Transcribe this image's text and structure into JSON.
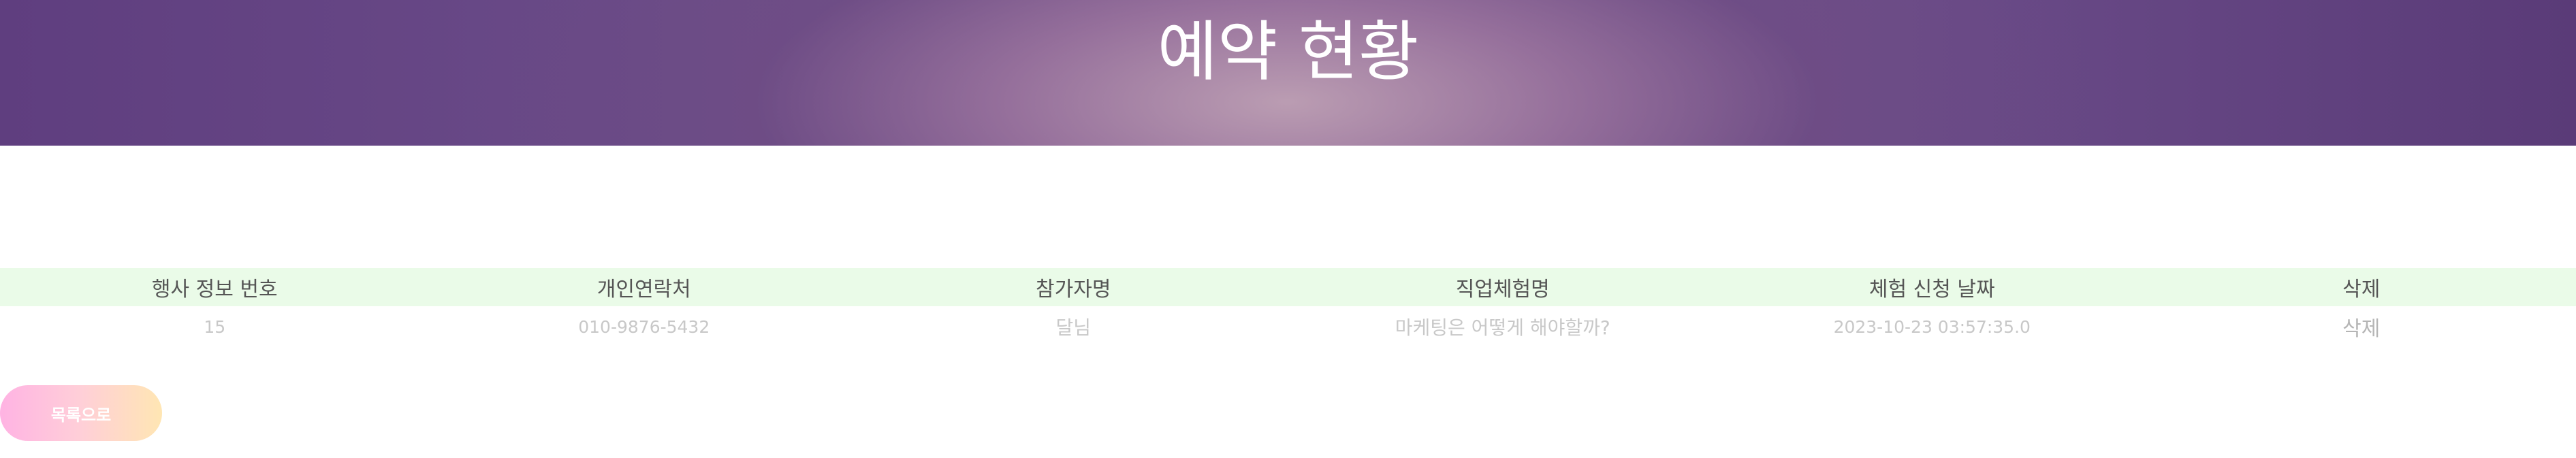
{
  "page": {
    "title": "예약 현황"
  },
  "table": {
    "headers": [
      "행사 정보 번호",
      "개인연락처",
      "참가자명",
      "직업체험명",
      "체험 신청 날짜",
      "삭제"
    ],
    "rows": [
      {
        "event_no": "15",
        "phone": "010-9876-5432",
        "participant": "달님",
        "program": "마케팅은 어떻게 해야할까?",
        "date": "2023-10-23 03:57:35.0",
        "delete_label": "삭제"
      }
    ]
  },
  "actions": {
    "back_label": "목록으로"
  },
  "colors": {
    "header_bg": "#eafbe8",
    "banner_purple": "#6a4b88",
    "button_gradient_start": "#ffb3e3",
    "button_gradient_end": "#ffe6b3"
  }
}
